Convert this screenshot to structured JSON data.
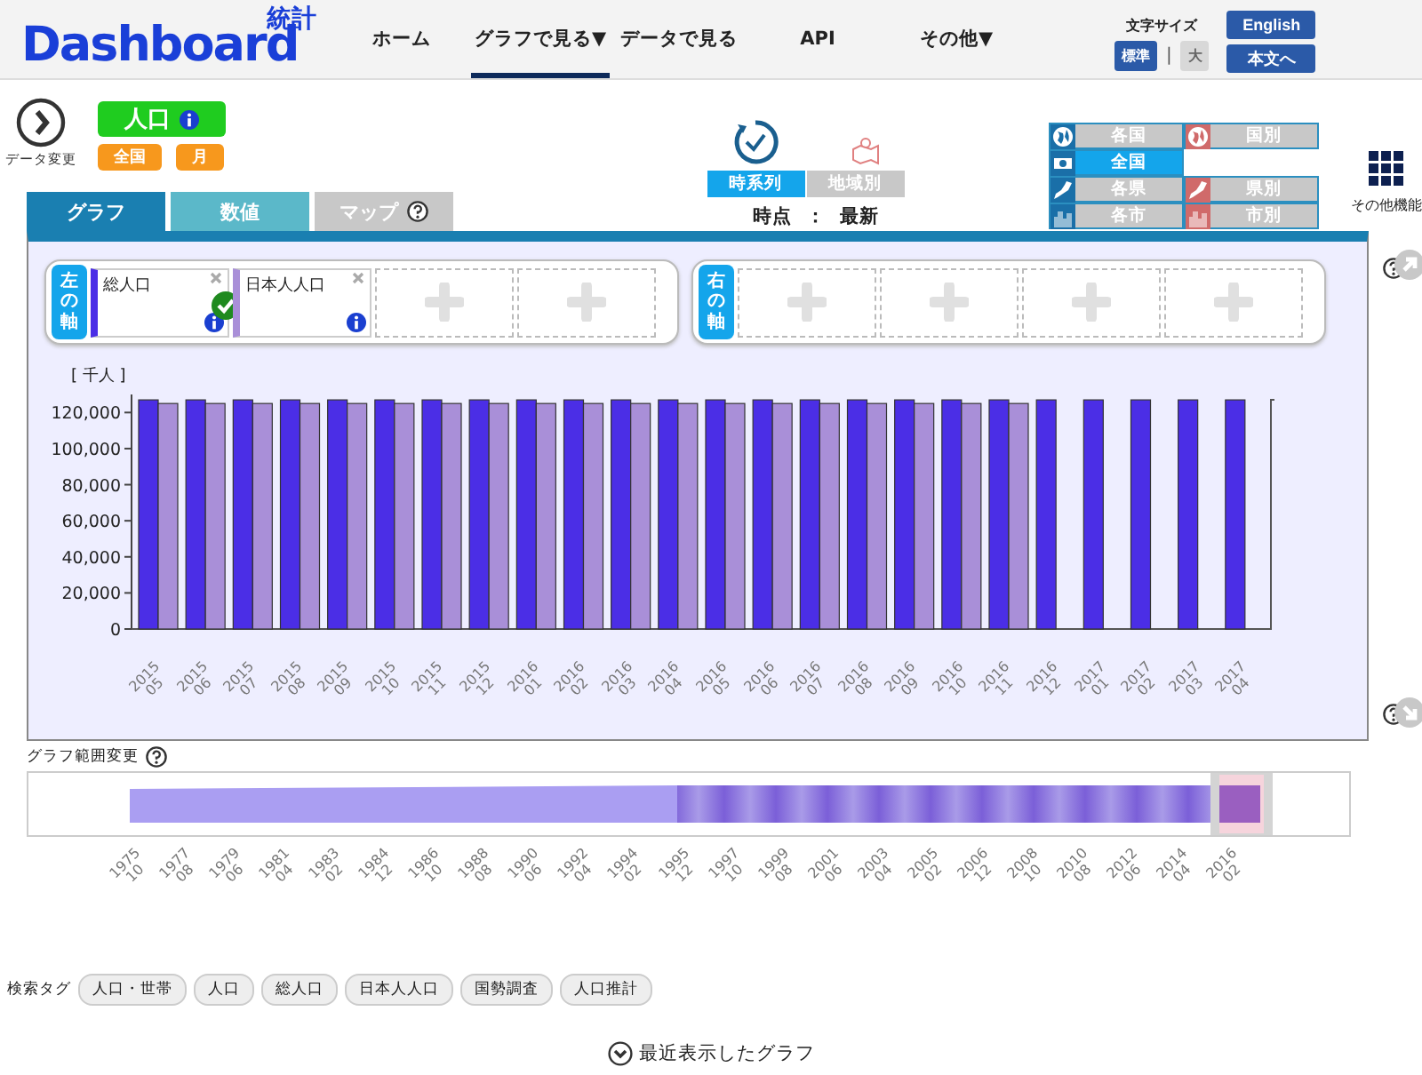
{
  "header": {
    "logo": {
      "text": "Dashboard",
      "sub": "統計"
    },
    "nav": [
      {
        "label": "ホーム",
        "selected": false
      },
      {
        "label": "グラフで見る▼",
        "selected": true
      },
      {
        "label": "データで見る",
        "selected": false
      },
      {
        "label": "API",
        "selected": false
      },
      {
        "label": "その他▼",
        "selected": false
      }
    ],
    "font_size": {
      "label": "文字サイズ",
      "options": [
        {
          "label": "標準",
          "selected": true
        },
        {
          "label": "大",
          "selected": false
        }
      ],
      "separator": "|"
    },
    "buttons": [
      "English",
      "本文へ"
    ]
  },
  "controls": {
    "change_label": "データ変更",
    "indicator": "人口",
    "area": "全国",
    "cycle": "月",
    "modes": [
      {
        "label": "時系列",
        "selected": true
      },
      {
        "label": "地域別",
        "selected": false
      }
    ],
    "time_point": {
      "label": "時点",
      "separator": "：",
      "value": "最新"
    },
    "regions": [
      {
        "label": "各国",
        "kind": "globe",
        "selected": false
      },
      {
        "label": "国別",
        "kind": "globe-red",
        "selected": false
      },
      {
        "label": "全国",
        "kind": "flag",
        "selected": true
      },
      {
        "label": "各県",
        "kind": "japan",
        "selected": false
      },
      {
        "label": "県別",
        "kind": "japan-red",
        "selected": false
      },
      {
        "label": "各市",
        "kind": "city",
        "selected": false
      },
      {
        "label": "市別",
        "kind": "city-red",
        "selected": false
      }
    ],
    "more": "その他機能"
  },
  "tabs": [
    {
      "label": "グラフ",
      "selected": true,
      "help": false
    },
    {
      "label": "数値",
      "selected": false,
      "help": false
    },
    {
      "label": "マップ",
      "selected": false,
      "help": true
    }
  ],
  "axes": [
    {
      "label": "左の軸",
      "slots": [
        {
          "kind": "series",
          "name": "総人口",
          "color": "#4b2ee6",
          "checked": true
        },
        {
          "kind": "series",
          "name": "日本人人口",
          "color": "#a98fd8",
          "checked": false
        },
        {
          "kind": "empty"
        },
        {
          "kind": "empty"
        }
      ]
    },
    {
      "label": "右の軸",
      "slots": [
        {
          "kind": "empty"
        },
        {
          "kind": "empty"
        },
        {
          "kind": "empty"
        },
        {
          "kind": "empty"
        }
      ]
    }
  ],
  "chart_data": {
    "type": "bar",
    "ylabel": "[ 千人 ]",
    "categories": [
      "2015 05",
      "2015 06",
      "2015 07",
      "2015 08",
      "2015 09",
      "2015 10",
      "2015 11",
      "2015 12",
      "2016 01",
      "2016 02",
      "2016 03",
      "2016 04",
      "2016 05",
      "2016 06",
      "2016 07",
      "2016 08",
      "2016 09",
      "2016 10",
      "2016 11",
      "2016 12",
      "2017 01",
      "2017 02",
      "2017 03",
      "2017 04"
    ],
    "series": [
      {
        "color": "#4b2ee6",
        "values": [
          127000,
          127000,
          127000,
          127000,
          127000,
          127000,
          127000,
          127000,
          127000,
          127000,
          127000,
          127000,
          127000,
          127000,
          127000,
          127000,
          127000,
          127000,
          127000,
          127000,
          127000,
          127000,
          127000,
          127000
        ]
      },
      {
        "color": "#a98fd8",
        "values": [
          125000,
          125000,
          125000,
          125000,
          125000,
          125000,
          125000,
          125000,
          125000,
          125000,
          125000,
          125000,
          125000,
          125000,
          125000,
          125000,
          125000,
          125000,
          125000,
          null,
          null,
          null,
          null,
          null
        ]
      }
    ],
    "ylim": [
      0,
      130000
    ],
    "yticks": [
      {
        "value": 0,
        "label": "0"
      },
      {
        "value": 20000,
        "label": "20,000"
      },
      {
        "value": 40000,
        "label": "40,000"
      },
      {
        "value": 60000,
        "label": "60,000"
      },
      {
        "value": 80000,
        "label": "80,000"
      },
      {
        "value": 100000,
        "label": "100,000"
      },
      {
        "value": 120000,
        "label": "120,000"
      }
    ]
  },
  "range": {
    "title": "グラフ範囲変更",
    "labels": [
      "1975 10",
      "1977 08",
      "1979 06",
      "1981 04",
      "1983 02",
      "1984 12",
      "1986 10",
      "1988 08",
      "1990 06",
      "1992 04",
      "1994 02",
      "1995 12",
      "1997 10",
      "1999 08",
      "2001 06",
      "2003 04",
      "2005 02",
      "2006 12",
      "2008 10",
      "2010 08",
      "2012 06",
      "2014 04",
      "2016 02"
    ]
  },
  "tags": {
    "label": "検索タグ",
    "items": [
      "人口・世帯",
      "人口",
      "総人口",
      "日本人人口",
      "国勢調査",
      "人口推計"
    ]
  },
  "recent": "最近表示したグラフ"
}
